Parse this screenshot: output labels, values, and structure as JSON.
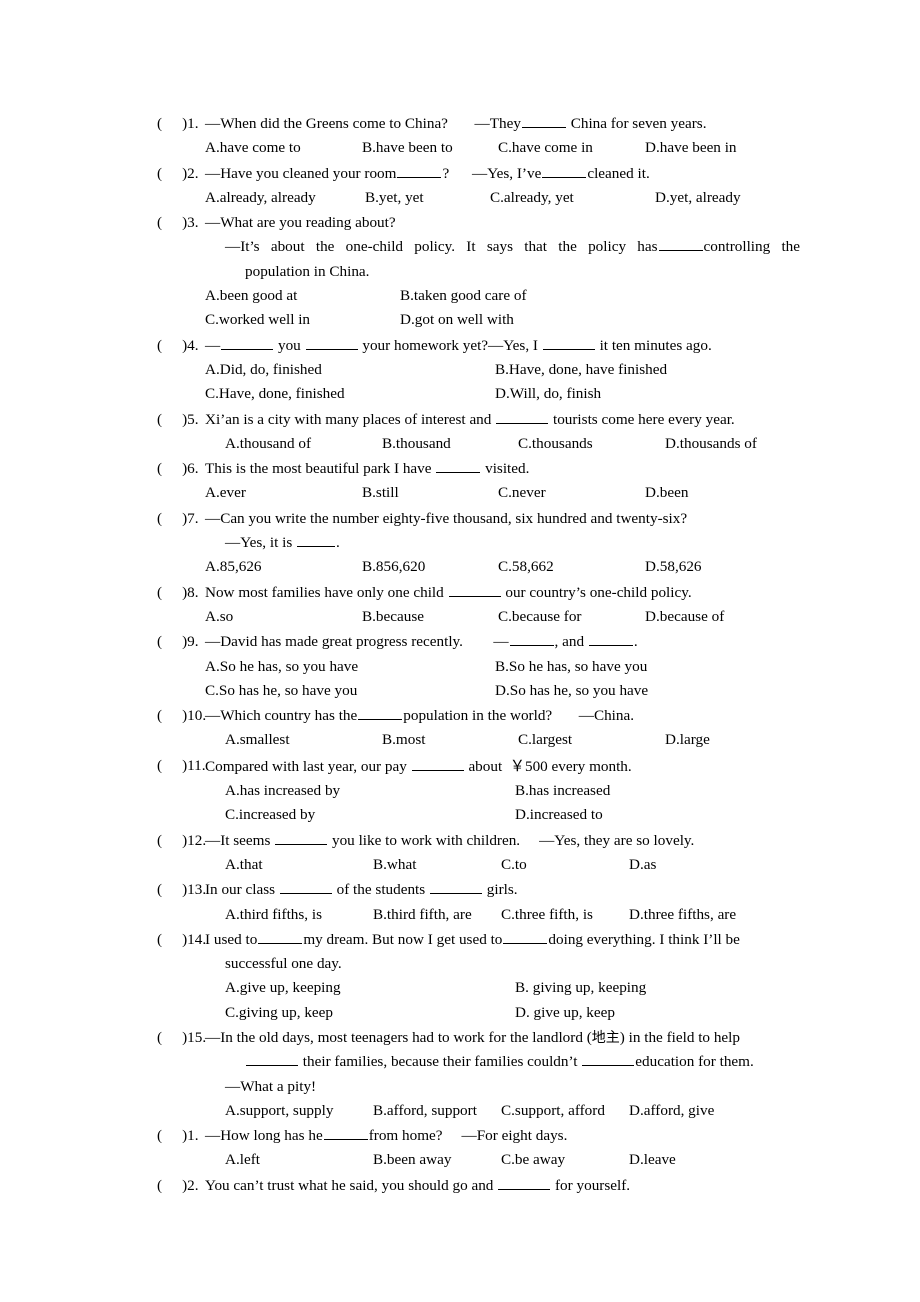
{
  "document": {
    "type": "english-grammar-multiple-choice-worksheet",
    "marker_open": "(",
    "marker_close": ")",
    "dash": "—",
    "questions": [
      {
        "number": "1.",
        "stem_before": "—When did the Greens come to China?",
        "stem_middle": "—They",
        "stem_after": "China for seven years.",
        "options": [
          "A.have come to",
          "B.have been to",
          "C.have come in",
          "D.have been in"
        ]
      },
      {
        "number": "2.",
        "stem_before": "—Have you cleaned your room",
        "stem_middle": "?",
        "stem_after2": "—Yes, I’ve",
        "stem_after3": "cleaned it.",
        "options": [
          "A.already, already",
          "B.yet, yet",
          "C.already, yet",
          "D.yet, already"
        ]
      },
      {
        "number": "3.",
        "stem_before": "—What are you reading about?",
        "line2_a": "—It’s about the one-child policy. It says that the policy has",
        "line2_b": "controlling the",
        "line3": "population in China.",
        "options": [
          "A.been good at",
          "B.taken good care of",
          "C.worked well in",
          "D.got on well with"
        ]
      },
      {
        "number": "4.",
        "stem_before": "—",
        "stem_mid1": "you",
        "stem_mid2": "your homework yet?—Yes, I",
        "stem_after": "it ten minutes ago.",
        "options": [
          "A.Did, do, finished",
          "B.Have, done, have finished",
          "C.Have, done, finished",
          "D.Will, do, finish"
        ]
      },
      {
        "number": "5.",
        "stem_before": "Xi’an is a city with many places of interest and",
        "stem_after": "tourists come here every year.",
        "options": [
          "A.thousand of",
          "B.thousand",
          "C.thousands",
          "D.thousands of"
        ]
      },
      {
        "number": "6.",
        "stem_before": "This is the most beautiful park I have",
        "stem_after": "visited.",
        "options": [
          "A.ever",
          "B.still",
          "C.never",
          "D.been"
        ]
      },
      {
        "number": "7.",
        "stem_before": "—Can you write the number eighty-five thousand, six hundred and twenty-six?",
        "line2_a": "—Yes, it is",
        "line2_b": ".",
        "options": [
          "A.85,626",
          "B.856,620",
          "C.58,662",
          "D.58,626"
        ]
      },
      {
        "number": "8.",
        "stem_before": "Now most families have only one child",
        "stem_after": "our country’s one-child policy.",
        "options": [
          "A.so",
          "B.because",
          "C.because for",
          "D.because of"
        ]
      },
      {
        "number": "9.",
        "stem_before": "—David has made great progress recently.",
        "stem_middle": "—",
        "stem_after": ", and",
        "stem_after2": ".",
        "options": [
          "A.So he has, so you have",
          "B.So he has, so have you",
          "C.So has he, so have you",
          "D.So has he, so you have"
        ]
      },
      {
        "number": "10.",
        "stem_before": "—Which country has the",
        "stem_middle": "population in the world?",
        "stem_after": "—China.",
        "options": [
          "A.smallest",
          "B.most",
          "C.largest",
          "D.large"
        ]
      },
      {
        "number": "11.",
        "stem_before": "Compared with last year, our pay",
        "stem_after": "about",
        "currency": "￥",
        "amount": "500 every month.",
        "options": [
          "A.has increased by",
          "B.has increased",
          "C.increased by",
          "D.increased to"
        ]
      },
      {
        "number": "12.",
        "stem_before": "—It seems",
        "stem_middle": "you like to work with children.",
        "stem_after": "—Yes, they are so lovely.",
        "options": [
          "A.that",
          "B.what",
          "C.to",
          "D.as"
        ]
      },
      {
        "number": "13.",
        "stem_before": "In our class",
        "stem_middle": "of the students",
        "stem_after": "girls.",
        "options": [
          "A.third fifths, is",
          "B.third fifth, are",
          "C.three fifth, is",
          "D.three fifths, are"
        ]
      },
      {
        "number": "14.",
        "stem_before": "I used to",
        "stem_mid1": "my dream. But now I get used to",
        "stem_mid2": "doing everything. I think I’ll be",
        "line2": "successful one day.",
        "options": [
          "A.give up, keeping",
          "B. giving up, keeping",
          "C.giving up, keep",
          "D. give up, keep"
        ]
      },
      {
        "number": "15.",
        "stem_before": "—In the old days, most teenagers had to work for the landlord (",
        "gloss": "地主",
        "stem_after": ") in the field to help",
        "line2_a": "their families, because their families couldn’t",
        "line2_b": "education for them.",
        "line3": "—What a pity!",
        "options": [
          "A.support, supply",
          "B.afford, support",
          "C.support, afford",
          "D.afford, give"
        ]
      },
      {
        "number": "1.",
        "stem_before": "—How long has he",
        "stem_middle": "from home?",
        "stem_after": "—For eight days.",
        "options": [
          "A.left",
          "B.been away",
          "C.be away",
          "D.leave"
        ]
      },
      {
        "number": "2.",
        "stem_before": "You can’t trust what he said, you should go and",
        "stem_after": "for yourself.",
        "options": []
      }
    ]
  }
}
